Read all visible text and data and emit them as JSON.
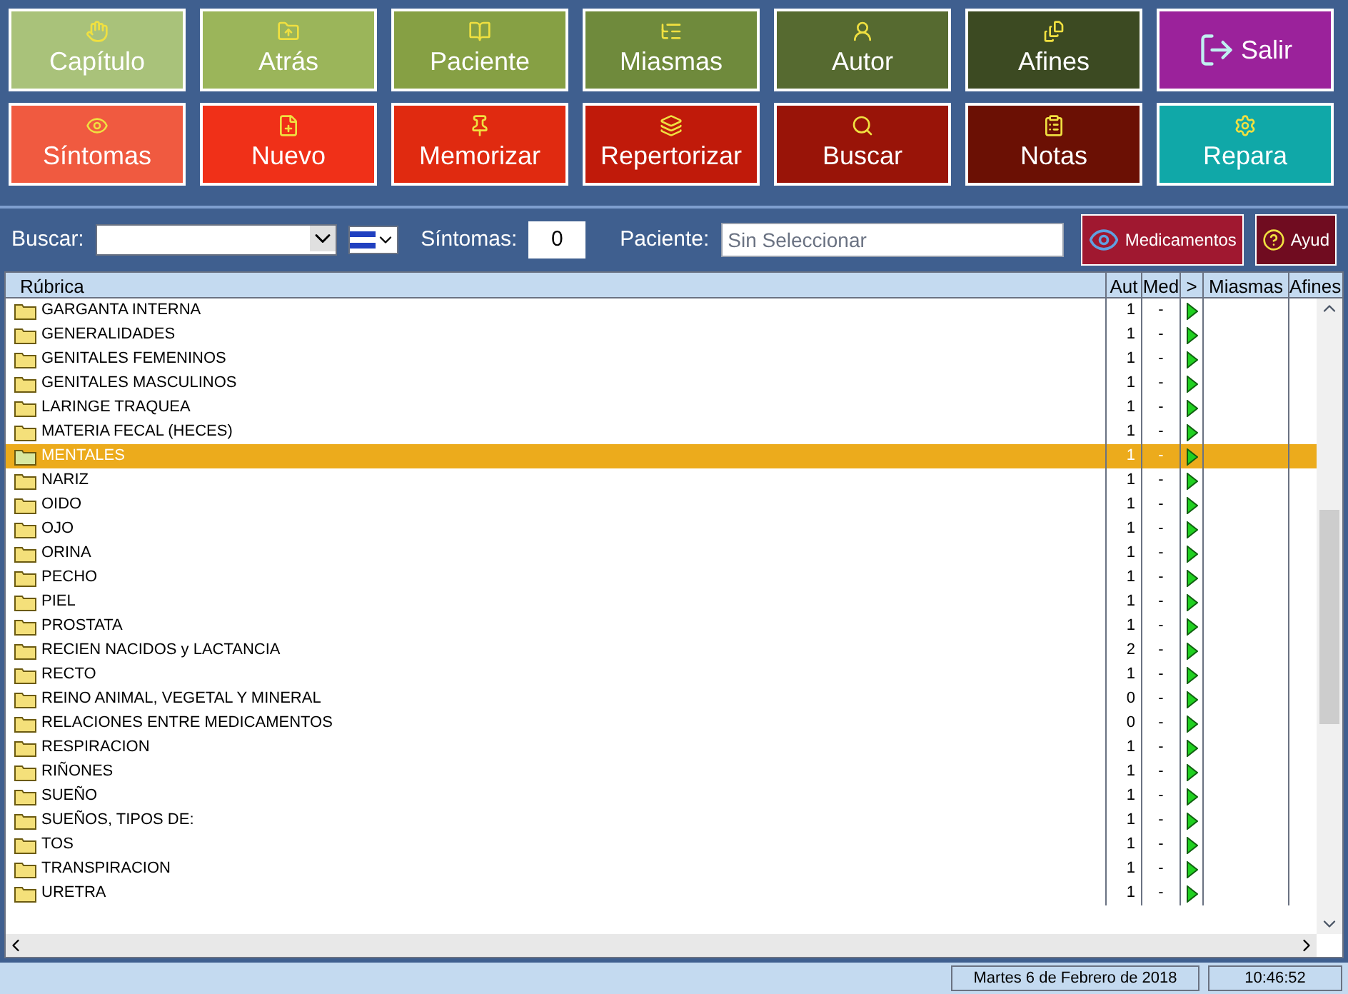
{
  "toolbar": {
    "rows": [
      [
        {
          "label": "Capítulo",
          "color": "#a9c27a"
        },
        {
          "label": "Atrás",
          "color": "#9bb55a"
        },
        {
          "label": "Paciente",
          "color": "#86a044"
        },
        {
          "label": "Miasmas",
          "color": "#6f8a3c"
        },
        {
          "label": "Autor",
          "color": "#566a30"
        },
        {
          "label": "Afines",
          "color": "#3c4a22"
        },
        {
          "label": "Salir",
          "color": "#9b229b"
        }
      ],
      [
        {
          "label": "Síntomas",
          "color": "#f05a40"
        },
        {
          "label": "Nuevo",
          "color": "#f03018"
        },
        {
          "label": "Memorizar",
          "color": "#e02a10"
        },
        {
          "label": "Repertorizar",
          "color": "#c01a0a"
        },
        {
          "label": "Buscar",
          "color": "#991408"
        },
        {
          "label": "Notas",
          "color": "#6b1004"
        },
        {
          "label": "Repara",
          "color": "#10a8a8"
        }
      ]
    ]
  },
  "search_bar": {
    "buscar_label": "Buscar:",
    "sintomas_label": "Síntomas:",
    "sintomas_value": "0",
    "paciente_label": "Paciente:",
    "paciente_placeholder": "Sin Seleccionar",
    "medicamentos_button": "Medicamentos",
    "ayuda_button": "Ayud"
  },
  "table": {
    "columns": [
      "Rúbrica",
      "Aut",
      "Med",
      ">",
      "Miasmas",
      "Afines"
    ],
    "rows": [
      {
        "name": "GARGANTA INTERNA",
        "aut": "1",
        "med": "-",
        "selected": false
      },
      {
        "name": "GENERALIDADES",
        "aut": "1",
        "med": "-",
        "selected": false
      },
      {
        "name": "GENITALES FEMENINOS",
        "aut": "1",
        "med": "-",
        "selected": false
      },
      {
        "name": "GENITALES  MASCULINOS",
        "aut": "1",
        "med": "-",
        "selected": false
      },
      {
        "name": "LARINGE TRAQUEA",
        "aut": "1",
        "med": "-",
        "selected": false
      },
      {
        "name": "MATERIA FECAL (HECES)",
        "aut": "1",
        "med": "-",
        "selected": false
      },
      {
        "name": "MENTALES",
        "aut": "1",
        "med": "-",
        "selected": true
      },
      {
        "name": "NARIZ",
        "aut": "1",
        "med": "-",
        "selected": false
      },
      {
        "name": "OIDO",
        "aut": "1",
        "med": "-",
        "selected": false
      },
      {
        "name": "OJO",
        "aut": "1",
        "med": "-",
        "selected": false
      },
      {
        "name": "ORINA",
        "aut": "1",
        "med": "-",
        "selected": false
      },
      {
        "name": "PECHO",
        "aut": "1",
        "med": "-",
        "selected": false
      },
      {
        "name": "PIEL",
        "aut": "1",
        "med": "-",
        "selected": false
      },
      {
        "name": "PROSTATA",
        "aut": "1",
        "med": "-",
        "selected": false
      },
      {
        "name": "RECIEN NACIDOS y LACTANCIA",
        "aut": "2",
        "med": "-",
        "selected": false
      },
      {
        "name": "RECTO",
        "aut": "1",
        "med": "-",
        "selected": false
      },
      {
        "name": "REINO ANIMAL, VEGETAL Y MINERAL",
        "aut": "0",
        "med": "-",
        "selected": false
      },
      {
        "name": "RELACIONES ENTRE MEDICAMENTOS",
        "aut": "0",
        "med": "-",
        "selected": false
      },
      {
        "name": "RESPIRACION",
        "aut": "1",
        "med": "-",
        "selected": false
      },
      {
        "name": "RIÑONES",
        "aut": "1",
        "med": "-",
        "selected": false
      },
      {
        "name": "SUEÑO",
        "aut": "1",
        "med": "-",
        "selected": false
      },
      {
        "name": "SUEÑOS, TIPOS DE:",
        "aut": "1",
        "med": "-",
        "selected": false
      },
      {
        "name": "TOS",
        "aut": "1",
        "med": "-",
        "selected": false
      },
      {
        "name": "TRANSPIRACION",
        "aut": "1",
        "med": "-",
        "selected": false
      },
      {
        "name": "URETRA",
        "aut": "1",
        "med": "-",
        "selected": false
      }
    ]
  },
  "status_bar": {
    "date": "Martes 6 de Febrero de 2018",
    "time": "10:46:52"
  }
}
